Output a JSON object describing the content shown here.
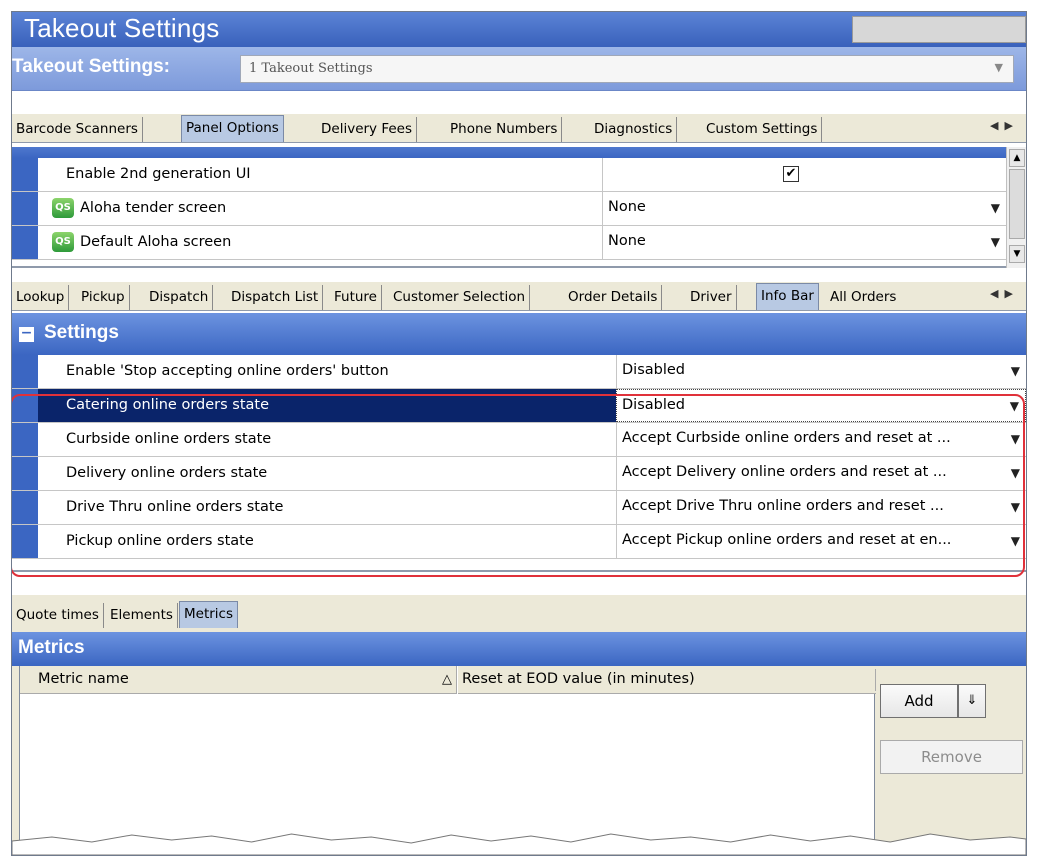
{
  "window": {
    "title": "Takeout Settings"
  },
  "selector": {
    "label": "Takeout Settings:",
    "value": "1 Takeout Settings"
  },
  "tabs_top": [
    {
      "label": "Barcode Scanners",
      "active": false
    },
    {
      "label": "Panel Options",
      "active": true
    },
    {
      "label": "Delivery Fees",
      "active": false
    },
    {
      "label": "Phone Numbers",
      "active": false
    },
    {
      "label": "Diagnostics",
      "active": false
    },
    {
      "label": "Custom Settings",
      "active": false
    }
  ],
  "panel_options": {
    "rows": [
      {
        "name": "Enable 2nd generation UI",
        "checked": true
      },
      {
        "name": "Aloha tender screen",
        "value": "None",
        "icon": "qs-icon"
      },
      {
        "name": "Default Aloha screen",
        "value": "None",
        "icon": "qs-icon"
      }
    ]
  },
  "tabs_middle": [
    {
      "label": "Lookup",
      "active": false
    },
    {
      "label": "Pickup",
      "active": false
    },
    {
      "label": "Dispatch",
      "active": false
    },
    {
      "label": "Dispatch List",
      "active": false
    },
    {
      "label": "Future",
      "active": false
    },
    {
      "label": "Customer Selection",
      "active": false
    },
    {
      "label": "Order Details",
      "active": false
    },
    {
      "label": "Driver",
      "active": false
    },
    {
      "label": "Info Bar",
      "active": true
    },
    {
      "label": "All Orders",
      "active": false
    }
  ],
  "settings": {
    "title": "Settings",
    "rows": [
      {
        "name": "Enable 'Stop accepting online orders' button",
        "value": "Disabled",
        "selected": false
      },
      {
        "name": "Catering online orders state",
        "value": "Disabled",
        "selected": true
      },
      {
        "name": "Curbside online orders state",
        "value": "Accept Curbside online orders and reset at ...",
        "selected": false
      },
      {
        "name": "Delivery online orders state",
        "value": "Accept Delivery online orders and reset at ...",
        "selected": false
      },
      {
        "name": "Drive Thru online orders state",
        "value": "Accept Drive Thru online orders and reset ...",
        "selected": false
      },
      {
        "name": "Pickup online orders state",
        "value": "Accept Pickup online orders and reset at en...",
        "selected": false
      }
    ]
  },
  "tabs_bottom": [
    {
      "label": "Quote times",
      "active": false
    },
    {
      "label": "Elements",
      "active": false
    },
    {
      "label": "Metrics",
      "active": true
    }
  ],
  "metrics": {
    "title": "Metrics",
    "columns": [
      "Metric name",
      "Reset at EOD value (in minutes)"
    ],
    "add_label": "Add",
    "remove_label": "Remove"
  },
  "colors": {
    "header_blue": "#3b66c2",
    "selected_row": "#0a246a",
    "highlight_red": "#e0313a"
  }
}
